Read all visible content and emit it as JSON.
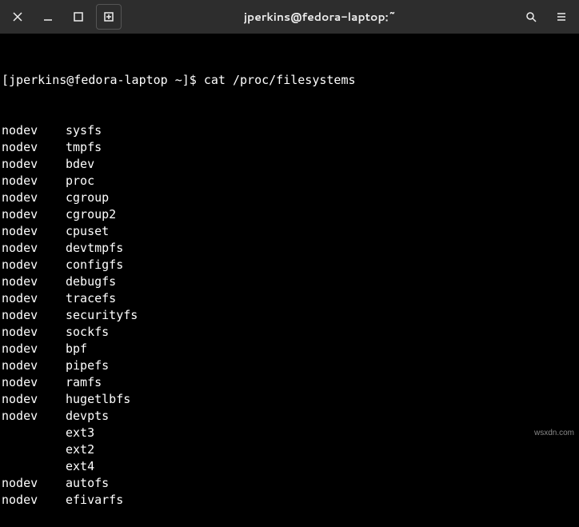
{
  "window": {
    "title": "jperkins@fedora-laptop:~"
  },
  "prompt": {
    "text": "[jperkins@fedora-laptop ~]$ ",
    "command": "cat /proc/filesystems"
  },
  "filesystems": [
    {
      "col1": "nodev",
      "col2": "sysfs"
    },
    {
      "col1": "nodev",
      "col2": "tmpfs"
    },
    {
      "col1": "nodev",
      "col2": "bdev"
    },
    {
      "col1": "nodev",
      "col2": "proc"
    },
    {
      "col1": "nodev",
      "col2": "cgroup"
    },
    {
      "col1": "nodev",
      "col2": "cgroup2"
    },
    {
      "col1": "nodev",
      "col2": "cpuset"
    },
    {
      "col1": "nodev",
      "col2": "devtmpfs"
    },
    {
      "col1": "nodev",
      "col2": "configfs"
    },
    {
      "col1": "nodev",
      "col2": "debugfs"
    },
    {
      "col1": "nodev",
      "col2": "tracefs"
    },
    {
      "col1": "nodev",
      "col2": "securityfs"
    },
    {
      "col1": "nodev",
      "col2": "sockfs"
    },
    {
      "col1": "nodev",
      "col2": "bpf"
    },
    {
      "col1": "nodev",
      "col2": "pipefs"
    },
    {
      "col1": "nodev",
      "col2": "ramfs"
    },
    {
      "col1": "nodev",
      "col2": "hugetlbfs"
    },
    {
      "col1": "nodev",
      "col2": "devpts"
    },
    {
      "col1": "",
      "col2": "ext3"
    },
    {
      "col1": "",
      "col2": "ext2"
    },
    {
      "col1": "",
      "col2": "ext4"
    },
    {
      "col1": "nodev",
      "col2": "autofs"
    },
    {
      "col1": "nodev",
      "col2": "efivarfs"
    }
  ],
  "watermark": "wsxdn.com"
}
